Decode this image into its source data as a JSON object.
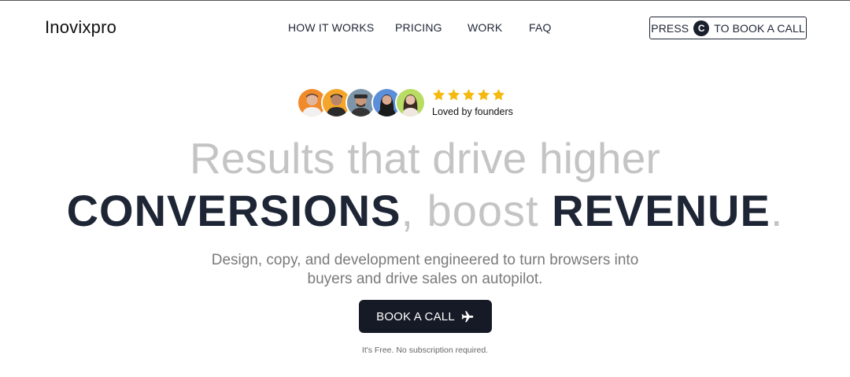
{
  "header": {
    "logo": "Inovixpro",
    "nav": [
      "HOW IT WORKS",
      "PRICING",
      "WORK",
      "FAQ"
    ],
    "press_button": {
      "prefix": "PRESS",
      "key": "C",
      "suffix": "TO BOOK A CALL"
    }
  },
  "social_proof": {
    "rating": 5,
    "label": "Loved by founders",
    "star_color": "#f5b90f"
  },
  "hero": {
    "line1": "Results that drive higher",
    "line2": {
      "word1": "CONVERSIONS",
      "sep": ", boost ",
      "word2": "REVENUE",
      "end": "."
    },
    "subtitle": "Design, copy, and development engineered to turn browsers into buyers and drive sales on autopilot.",
    "cta_label": "BOOK A CALL",
    "cta_icon": "plane-icon",
    "note": "It's Free. No subscription required."
  },
  "colors": {
    "dark": "#1e2535",
    "muted": "#c4c4c4",
    "cta_bg": "#151a26"
  }
}
